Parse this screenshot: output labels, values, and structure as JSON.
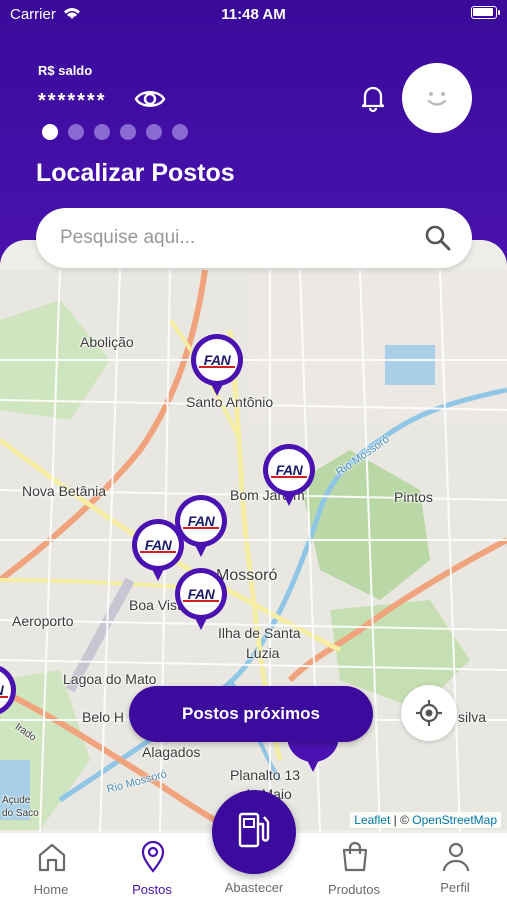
{
  "status_bar": {
    "carrier": "Carrier",
    "time": "11:48 AM"
  },
  "header": {
    "balance_label": "R$ saldo",
    "balance_value": "*******",
    "page_title": "Localizar Postos",
    "carousel_pages": 6,
    "carousel_active": 1
  },
  "search": {
    "placeholder": "Pesquise aqui..."
  },
  "map": {
    "labels": {
      "abolicao": "Abolição",
      "santo_antonio": "Santo Antônio",
      "bom_jardim": "Bom Jardim",
      "pintos": "Pintos",
      "nova_betania": "Nova Betânia",
      "mossoro": "Mossoró",
      "boa_vista": "Boa Vista",
      "aeroporto": "Aeroporto",
      "ilha_santa": "Ilha de Santa",
      "luzia": "Luzia",
      "lagoa_mato": "Lagoa do Mato",
      "belo_horizonte": "Belo H",
      "silva": "silva",
      "alagados": "Alagados",
      "planalto": "Planalto 13",
      "maio": "de Maio",
      "rio_mossoro_1": "Rio Mossoró",
      "rio_mossoro_2": "Rio Mossoró",
      "acude": "Açude",
      "saco": "do Saco",
      "road_label": "Irado"
    },
    "station_logo_text": "FAN",
    "attribution": {
      "leaflet": "Leaflet",
      "separator": " | © ",
      "osm": "OpenStreetMap"
    }
  },
  "actions": {
    "nearby_button": "Postos próximos"
  },
  "tabbar": {
    "home": "Home",
    "postos": "Postos",
    "abastecer": "Abastecer",
    "produtos": "Produtos",
    "perfil": "Perfil"
  },
  "colors": {
    "brand_purple": "#4a12b0",
    "header_dark": "#3a0a9a",
    "inactive_tab": "#6b6b6b"
  }
}
